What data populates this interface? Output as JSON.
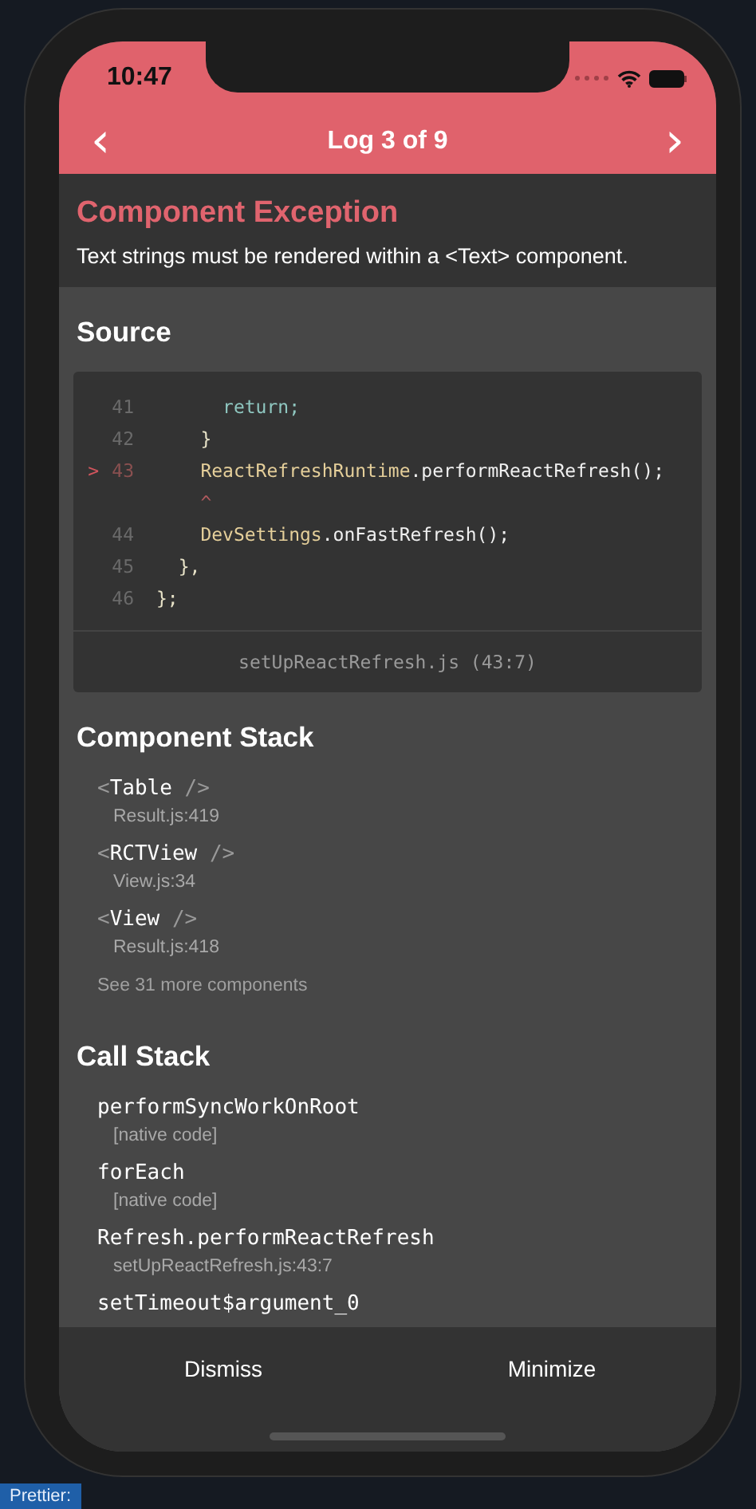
{
  "status_bar": {
    "time": "10:47"
  },
  "nav": {
    "prev": "‹",
    "title": "Log 3 of 9",
    "next": "›"
  },
  "exception": {
    "title": "Component Exception",
    "message": "Text strings must be rendered within a <Text> component."
  },
  "source": {
    "heading": "Source",
    "file": "setUpReactRefresh.js (43:7)",
    "lines": [
      {
        "number": "41",
        "segments": [
          {
            "text": "      return;",
            "kind": "keyword"
          }
        ]
      },
      {
        "number": "42",
        "segments": [
          {
            "text": "    }",
            "kind": "punct"
          }
        ]
      },
      {
        "number": "43",
        "marker": ">",
        "segments": [
          {
            "text": "    ReactRefreshRuntime",
            "kind": "identifier"
          },
          {
            "text": ".performReactRefresh();",
            "kind": "plain"
          }
        ]
      },
      {
        "segments": [
          {
            "text": "    ^",
            "kind": "pointer"
          }
        ]
      },
      {
        "number": "44",
        "segments": [
          {
            "text": "    DevSettings",
            "kind": "identifier"
          },
          {
            "text": ".onFastRefresh();",
            "kind": "plain"
          }
        ]
      },
      {
        "number": "45",
        "segments": [
          {
            "text": "  },",
            "kind": "punct"
          }
        ]
      },
      {
        "number": "46",
        "segments": [
          {
            "text": "};",
            "kind": "punct"
          }
        ]
      }
    ]
  },
  "component_stack": {
    "heading": "Component Stack",
    "items": [
      {
        "open": "<",
        "name": "Table",
        "close": "/>",
        "location": "Result.js:419"
      },
      {
        "open": "<",
        "name": "RCTView",
        "close": "/>",
        "location": "View.js:34"
      },
      {
        "open": "<",
        "name": "View",
        "close": "/>",
        "location": "Result.js:418"
      }
    ],
    "more": "See 31 more components"
  },
  "call_stack": {
    "heading": "Call Stack",
    "frames": [
      {
        "name": "performSyncWorkOnRoot",
        "location": "[native code]"
      },
      {
        "name": "forEach",
        "location": "[native code]"
      },
      {
        "name": "Refresh.performReactRefresh",
        "location": "setUpReactRefresh.js:43:7"
      },
      {
        "name": "setTimeout$argument_0"
      }
    ]
  },
  "buttons": [
    "Dismiss",
    "Minimize"
  ],
  "taskbar": {
    "item": "Prettier:"
  }
}
